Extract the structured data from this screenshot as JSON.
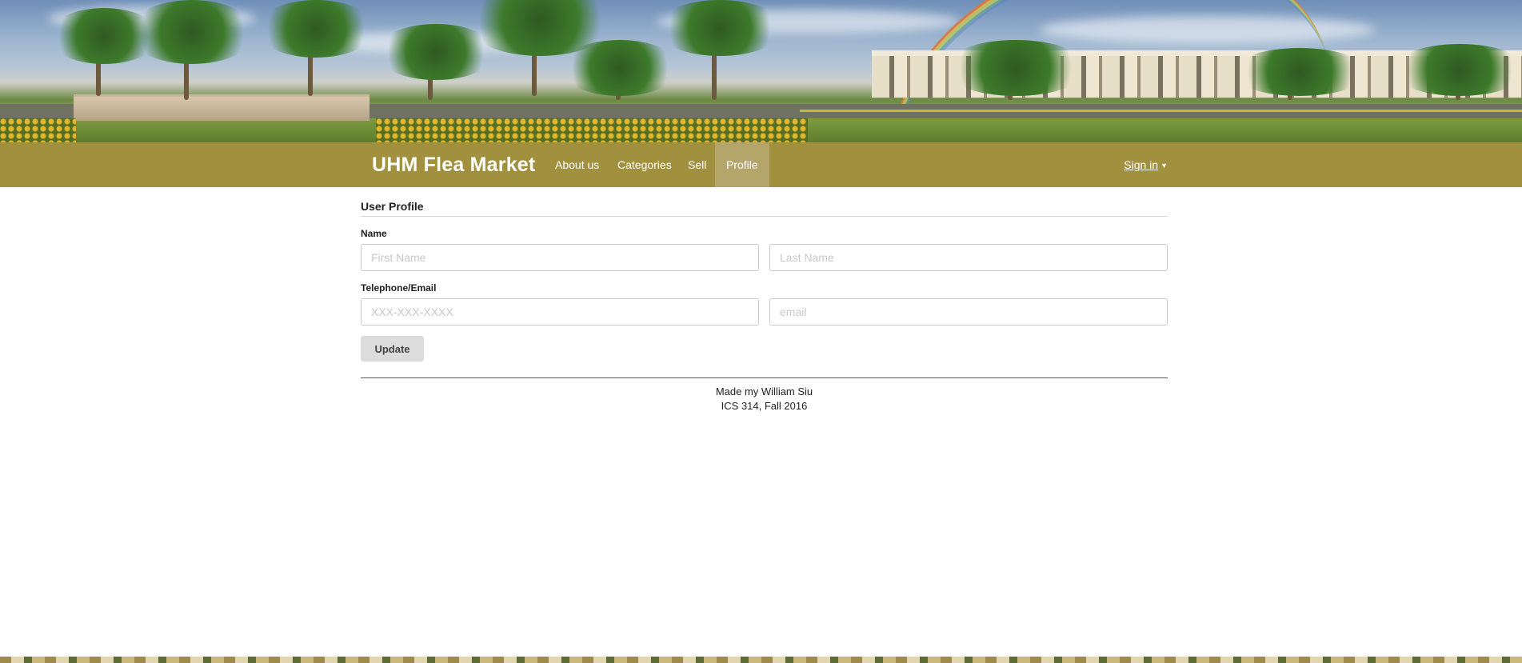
{
  "site": {
    "brand": "UHM Flea Market"
  },
  "nav": {
    "items": [
      {
        "label": "About us"
      },
      {
        "label": "Categories"
      },
      {
        "label": "Sell"
      },
      {
        "label": "Profile",
        "active": true
      }
    ],
    "signin_label": "Sign in",
    "signin_caret": "▼"
  },
  "profile": {
    "title": "User Profile",
    "name_label": "Name",
    "first_name": {
      "value": "",
      "placeholder": "First Name"
    },
    "last_name": {
      "value": "",
      "placeholder": "Last Name"
    },
    "contact_label": "Telephone/Email",
    "phone": {
      "value": "",
      "placeholder": "XXX-XXX-XXXX"
    },
    "email": {
      "value": "",
      "placeholder": "email"
    },
    "update_label": "Update"
  },
  "footer": {
    "line1": "Made my William Siu",
    "line2": "ICS 314, Fall 2016"
  },
  "colors": {
    "navbar": "#a1913f",
    "nav_active": "#b4a56a",
    "button_bg": "#dcdcdc"
  }
}
